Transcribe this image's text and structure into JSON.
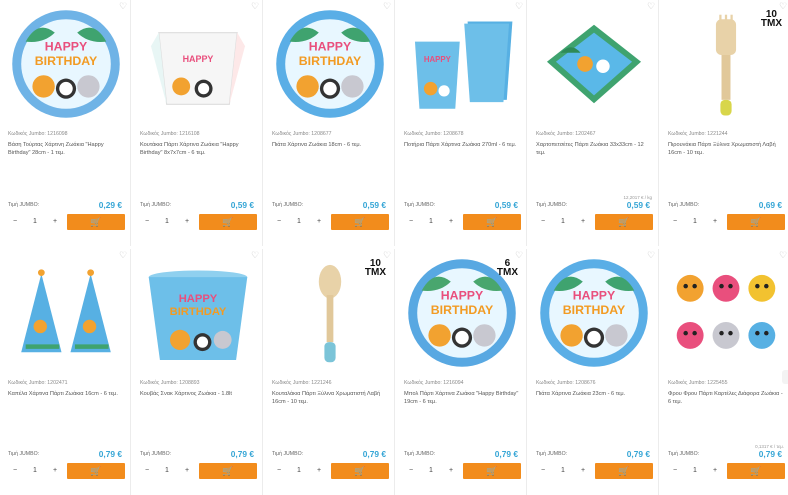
{
  "labels": {
    "price_label": "Τιμή JUMBO:",
    "minus": "−",
    "plus": "+",
    "wishlist": "♡",
    "cart": "🛒"
  },
  "products": [
    {
      "code": "Κωδικός Jumbo: 1216098",
      "title": "Βάση Τούρτας Χάρτινη Ζωάκια \"Happy Birthday\" 28cm - 1 τεμ.",
      "price": "0,29 €",
      "qty": "1",
      "unit": "",
      "badge": "",
      "image": "party-plate-tray"
    },
    {
      "code": "Κωδικός Jumbo: 1216108",
      "title": "Κουτάκια Πάρτι Χάρτινα Ζωάκια \"Happy Birthday\" 8x7x7cm - 6 τεμ.",
      "price": "0,59 €",
      "qty": "1",
      "unit": "",
      "badge": "",
      "image": "party-box"
    },
    {
      "code": "Κωδικός Jumbo: 1208677",
      "title": "Πιάτα Χάρτινα Ζωάκια 18cm - 6 τεμ.",
      "price": "0,59 €",
      "qty": "1",
      "unit": "",
      "badge": "",
      "image": "party-plate"
    },
    {
      "code": "Κωδικός Jumbo: 1208678",
      "title": "Ποτήρια Πάρτι Χάρτινα Ζωάκια 270ml - 6 τεμ.",
      "price": "0,59 €",
      "qty": "1",
      "unit": "",
      "badge": "",
      "image": "party-cups"
    },
    {
      "code": "Κωδικός Jumbo: 1202467",
      "title": "Χαρτοπετσέτες Πάρτι Ζωάκια 33x33cm - 12 τεμ.",
      "price": "0,59 €",
      "qty": "1",
      "unit": "12,2017 € / kg",
      "badge": "",
      "image": "party-napkins"
    },
    {
      "code": "Κωδικός Jumbo: 1221244",
      "title": "Πιρουνάκια Πάρτι Ξύλινα Χρωματιστή Λαβή 16cm - 10 τεμ.",
      "price": "0,69 €",
      "qty": "1",
      "unit": "",
      "badge": "10\nΤΜΧ",
      "image": "wooden-fork"
    },
    {
      "code": "Κωδικός Jumbo: 1202471",
      "title": "Καπέλα Χάρτινα Πάρτι Ζωάκια 16cm - 6 τεμ.",
      "price": "0,79 €",
      "qty": "1",
      "unit": "",
      "badge": "",
      "image": "party-hats"
    },
    {
      "code": "Κωδικός Jumbo: 1208893",
      "title": "Κουβάς Σνακ Χάρτινος Ζωάκια - 1.8lt",
      "price": "0,79 €",
      "qty": "1",
      "unit": "",
      "badge": "",
      "image": "snack-bucket"
    },
    {
      "code": "Κωδικός Jumbo: 1221246",
      "title": "Κουταλάκια Πάρτι Ξύλινα Χρωματιστή Λαβή 16cm - 10 τεμ.",
      "price": "0,79 €",
      "qty": "1",
      "unit": "",
      "badge": "10\nΤΜΧ",
      "image": "wooden-spoon"
    },
    {
      "code": "Κωδικός Jumbo: 1216094",
      "title": "Μπολ Πάρτι Χάρτινα Ζωάκια \"Happy Birthday\" 19cm - 6 τεμ.",
      "price": "0,79 €",
      "qty": "1",
      "unit": "",
      "badge": "6\nΤΜΧ",
      "image": "party-bowl"
    },
    {
      "code": "Κωδικός Jumbo: 1208676",
      "title": "Πιάτα Χάρτινα Ζωάκια 23cm - 6 τεμ.",
      "price": "0,79 €",
      "qty": "1",
      "unit": "",
      "badge": "",
      "image": "party-plate-large"
    },
    {
      "code": "Κωδικός Jumbo: 1225455",
      "title": "Φρου Φρου Πάρτι Καρτέλες Διάφορα Ζωάκια - 6 τεμ.",
      "price": "0,79 €",
      "qty": "1",
      "unit": "0,1317 € / τεμ.",
      "badge": "",
      "image": "party-blowers"
    }
  ],
  "colors": {
    "price": "#37a6d6",
    "cart_button": "#f28c1c"
  }
}
